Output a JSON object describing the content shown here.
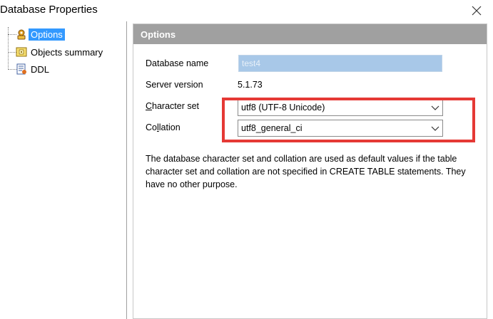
{
  "window": {
    "title": "Database Properties",
    "close_icon": "close-icon"
  },
  "tree": {
    "items": [
      {
        "label": "Options",
        "icon": "options-icon",
        "selected": true
      },
      {
        "label": "Objects summary",
        "icon": "objects-summary-icon",
        "selected": false
      },
      {
        "label": "DDL",
        "icon": "ddl-icon",
        "selected": false
      }
    ]
  },
  "panel": {
    "header": "Options",
    "database_name_label": "Database name",
    "database_name_value": "test4",
    "server_version_label": "Server version",
    "server_version_value": "5.1.73",
    "character_set_label_prefix": "C",
    "character_set_label_rest": "haracter set",
    "character_set_value": "utf8 (UTF-8 Unicode)",
    "collation_label_prefix": "Co",
    "collation_label_underlined": "l",
    "collation_label_rest": "lation",
    "collation_value": "utf8_general_ci",
    "description": "The database character set and collation are used as default values if the table character set and collation are not specified in CREATE TABLE statements. They have no other purpose."
  },
  "colors": {
    "selection": "#3399ff",
    "header_bg": "#a0a0a0",
    "highlight_border": "#e53935",
    "disabled_input_bg": "#a8c8e8"
  }
}
